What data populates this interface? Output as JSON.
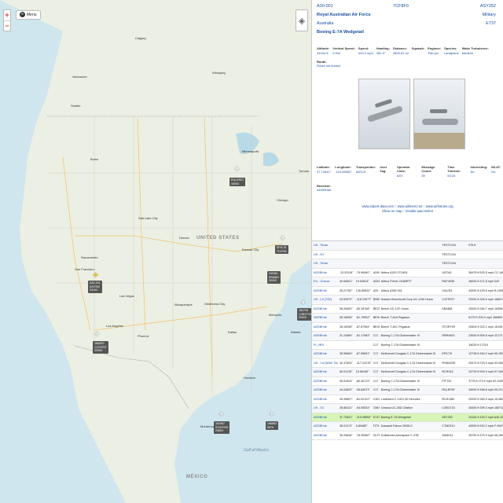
{
  "map": {
    "menu_label": "Menu",
    "zoom_in": "+",
    "zoom_out": "−",
    "layers_icon": "layers-icon",
    "labels": {
      "calgary": "Calgary",
      "winnipeg": "Winnipeg",
      "vancouver": "Vancouver",
      "seattle": "Seattle",
      "minneapolis": "Minneapolis",
      "chicago": "Chicago",
      "toronto": "Toronto",
      "boise": "Boise",
      "salt_lake": "Salt Lake City",
      "denver": "Denver",
      "united_states": "UNITED STATES",
      "kansas_city": "Kansas City",
      "sacramento": "Sacramento",
      "san_francisco": "San Francisco",
      "las_vegas": "Las Vegas",
      "los_angeles": "Los Angeles",
      "phoenix": "Phoenix",
      "albuquerque": "Albuquerque",
      "oklahoma": "Oklahoma City",
      "dallas": "Dallas",
      "houston": "Houston",
      "memphis": "Memphis",
      "atlanta": "Atlanta",
      "mexico": "MÉXICO",
      "monterrey": "Monterrey",
      "gulf": "Gulf of Mexico"
    },
    "aircraft": [
      {
        "tag": [
          "RULER57",
          "34000"
        ],
        "selected": false
      },
      {
        "tag": [
          "EPIC76",
          "7C0750"
        ],
        "selected": false
      },
      {
        "tag": [
          "HG350",
          "KBA861",
          "20000"
        ],
        "selected": false
      },
      {
        "tag": [
          "A30-001",
          "ASY252",
          "34164"
        ],
        "selected": true
      },
      {
        "tag": [
          "1682E0",
          "C13TEST",
          "22000"
        ],
        "selected": false
      },
      {
        "tag": [
          "160799",
          "LOBO715",
          "20000"
        ],
        "selected": false
      },
      {
        "tag": [
          "161957",
          "STORY99",
          "20604"
        ],
        "selected": false
      },
      {
        "tag": [
          "168853",
          "6575"
        ],
        "selected": false
      }
    ]
  },
  "detail": {
    "reg": "A30-001",
    "hex": "7CF8F0",
    "callsign": "ASY252",
    "operator": "Royal Australian Air Force",
    "country": "Australia",
    "type_name": "Boeing E-7A Wedgetail",
    "category": "Military",
    "type_code": "E737",
    "stats": [
      {
        "k": "Altitude:",
        "v": "34164 ft"
      },
      {
        "k": "Vertical Speed:",
        "v": "0 ft/m"
      },
      {
        "k": "Speed:",
        "v": "429.2 mph"
      },
      {
        "k": "Heading:",
        "v": "281.9°"
      },
      {
        "k": "Distance:",
        "v": "4559.81 mi"
      },
      {
        "k": "Squawk:",
        "v": ""
      },
      {
        "k": "Engines:",
        "v": "Twin jet"
      },
      {
        "k": "Species:",
        "v": "Landplane"
      },
      {
        "k": "Wake Turbulence:",
        "v": "Medium"
      }
    ],
    "route_k": "Route:",
    "route_v": "Route not known",
    "stats2": [
      {
        "k": "Latitude:",
        "v": "37.72841°"
      },
      {
        "k": "Longitude:",
        "v": "-119.08952°"
      },
      {
        "k": "Transponder:",
        "v": "ADS-B"
      },
      {
        "k": "User Tag:",
        "v": ""
      },
      {
        "k": "Operator Code:",
        "v": "ASY"
      },
      {
        "k": "Message Count:",
        "v": "39"
      },
      {
        "k": "Time Tracked:",
        "v": "00:23"
      },
      {
        "k": "Interesting:",
        "v": "No"
      },
      {
        "k": "MLAT:",
        "v": "No"
      }
    ],
    "receiver_k": "Receiver:",
    "receiver_v": "ADSBHub",
    "links_1": "www.airport-data.com :: www.airliners.net :: www.airframes.org",
    "links_2": "Show on map :: Enable auto-select"
  },
  "table": {
    "rows": [
      [
        "US - Texas",
        "",
        "",
        "",
        "",
        "TEST1234",
        "",
        "975 ft"
      ],
      [
        "US - NY",
        "",
        "",
        "",
        "",
        "TEST1234",
        "",
        ""
      ],
      [
        "US - Texas",
        "",
        "",
        "",
        "",
        "TEST1234",
        "",
        ""
      ],
      [
        "ADSBHub",
        "-13.53119°",
        "-75.99060°",
        "A20N",
        "Airbus A320 271NSL",
        "JAT041",
        "",
        "36475 ft 533.5 mph CC-AWL"
      ],
      [
        "EU - Greece",
        "40.64001°",
        "19.02814°",
        "A332",
        "Airbus Pherix 243MRTT",
        "RAF4038",
        "",
        "46000 ft 471.8 mph 042"
      ],
      [
        "ADSBHub",
        "35.21782°",
        "136.89522°",
        "A25",
        "Airbus A350 941",
        "CAL051",
        "",
        "40000 ft 429.6 mph B-18912"
      ],
      [
        "US - LA (T/W)",
        "33.53572°",
        "-118.23077°",
        "B35B",
        "Hawker Beechcraft Corp UC-12W Huron",
        "C12TEST",
        "",
        "22000 ft 349.9 mph 166574"
      ],
      [
        "ADSBHub",
        "38.26400°",
        "-80.28768°",
        "BE20",
        "Beech UC-12F Huron",
        "KBA861",
        "",
        "20000 ft 264.7 mph 163561"
      ],
      [
        "ADSBHub",
        "28.16506°",
        "-81.75902°",
        "BE9L",
        "Beech T-44A Pegasus",
        "",
        "",
        "6175 ft 209.3 mph 166853"
      ],
      [
        "ADSBHub",
        "28.15338°",
        "-87.87964°",
        "BE9L",
        "Beech T-44C Pegasus",
        "STORY09",
        "",
        "20604 ft 322.1 mph 161957"
      ],
      [
        "ADSBHub",
        "31.24589°",
        "-81.17583°",
        "C17",
        "Boeing C-17A Globemaster III",
        "RRR9400",
        "",
        "23000 ft 509.8 mph 22172"
      ],
      [
        "Pi_VRS",
        "",
        "",
        "C17",
        "Boeing C-17A Globemaster III",
        "",
        "",
        "34025 ft 17224"
      ],
      [
        "ADSBHub",
        "39.59684°",
        "-87.99691°",
        "C17",
        "McDonnell Douglas C-17A Globemaster III",
        "EPIC76",
        "",
        "12738 ft 454.2 mph 90-0535"
      ],
      [
        "US - CA (NAW Tom)",
        "32.47604°",
        "-117.22219°",
        "C17",
        "McDonnell Douglas C-17A Globemaster III",
        "RHW4295",
        "",
        "29473 ft 223.9 mph 93-0604"
      ],
      [
        "ADSBHub",
        "50.01135°",
        "10.66180°",
        "C17",
        "McDonnell Douglas C-17A Globemaster III",
        "RCH243",
        "",
        "24725 ft 549.9 mph 97-0044"
      ],
      [
        "ADSBHub",
        "45.51524°",
        "-80.40179°",
        "C17",
        "Boeing C-17A Globemaster III",
        "PITT02",
        "",
        "3775 ft 273.9 mph 02-1099"
      ],
      [
        "ADSBHub",
        "44.04820°",
        "-95.84071°",
        "C17",
        "Boeing C-17A Globemaster III",
        "RULER57",
        "",
        "34000 ft 468.8 mph 09-0170"
      ],
      [
        "ADSBHub",
        "26.99657°",
        "-81.02122°",
        "C30J",
        "Lockheed C-130J-30 Hercules",
        "RCH1180",
        "",
        "22000 ft 363.9 mph 15-5822"
      ],
      [
        "US - SC",
        "35.88121°",
        "-94.05534°",
        "C56X",
        "Cessna UC-35D Citation",
        "LOBO715",
        "",
        "30000 ft 399.3 mph 166715"
      ],
      [
        "ADSBHub",
        "37.72841°",
        "-119.08952°",
        "E737",
        "Boeing E-7A Wedgetail",
        "ASY252",
        "",
        "34164 ft 429.2 mph A30-001"
      ],
      [
        "ADSBHub",
        "45.01173°",
        "6.89485°",
        "F2TH",
        "Dassault Falcon 2000LX",
        "CTM0210",
        "",
        "40000 ft 520.2 mph F-RAFC"
      ],
      [
        "ADSBHub",
        "35.20846°",
        "-78.29060°",
        "GLF5",
        "Gulfstream Aerospace C-37B",
        "SAM012",
        "",
        "36700 ft 475.3 mph 06-0500"
      ]
    ],
    "selected_index": 19
  }
}
